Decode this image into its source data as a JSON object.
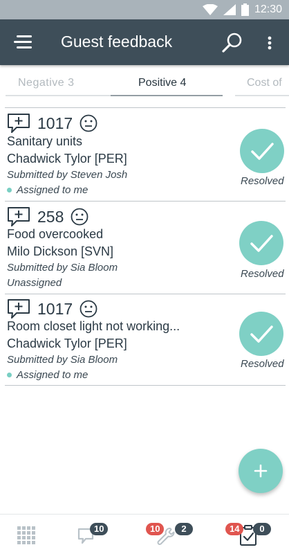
{
  "status_bar": {
    "time": "12:30"
  },
  "header": {
    "title": "Guest feedback",
    "icons": [
      "menu-icon",
      "search-icon",
      "more-vert-icon"
    ]
  },
  "tabs": [
    {
      "label": "Negative  3",
      "selected": false
    },
    {
      "label": "Positive 4",
      "selected": true
    },
    {
      "label": "Cost  of",
      "selected": false
    }
  ],
  "feedback_items": [
    {
      "number": "1017",
      "subject": "Sanitary units",
      "guest": "Chadwick Tylor [PER]",
      "submitted_by": "Submitted by Steven Josh",
      "assignment": "Assigned to me",
      "assigned": true,
      "status": "Resolved"
    },
    {
      "number": "258",
      "subject": "Food overcooked",
      "guest": "Milo Dickson [SVN]",
      "submitted_by": "Submitted by Sia Bloom",
      "assignment": "Unassigned",
      "assigned": false,
      "status": "Resolved"
    },
    {
      "number": "1017",
      "subject": "Room closet light not working...",
      "guest": "Chadwick Tylor [PER]",
      "submitted_by": "Submitted by Sia Bloom",
      "assignment": "Assigned to me",
      "assigned": true,
      "status": "Resolved"
    }
  ],
  "fab": {
    "icon": "plus-icon"
  },
  "bottom_nav": {
    "dashboard": {
      "icon": "grid-icon"
    },
    "feedback": {
      "icon": "chat-icon",
      "badge": "10"
    },
    "maintenance": {
      "icon": "wrench-icon",
      "badge_red": "10",
      "badge": "2"
    },
    "tasks": {
      "icon": "clipboard-check-icon",
      "badge_red": "14",
      "badge": "0"
    }
  },
  "colors": {
    "app_bar": "#3e4e59",
    "accent": "#7fd0c5",
    "badge_red": "#e0554f",
    "status_bar": "#a9b3ba"
  }
}
